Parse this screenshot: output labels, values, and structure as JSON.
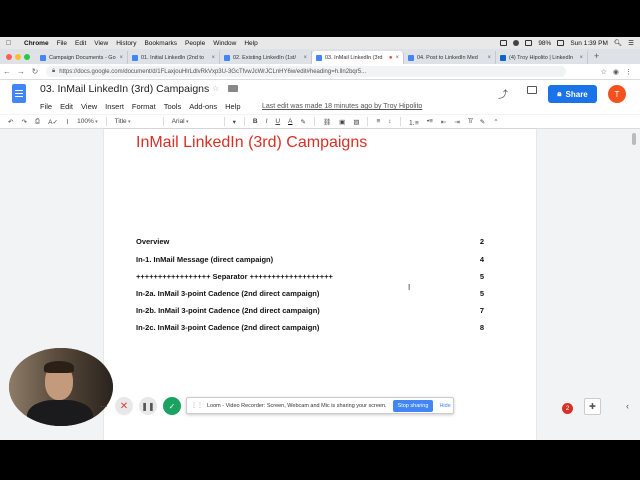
{
  "menubar": {
    "apple": "",
    "app": "Chrome",
    "items": [
      "File",
      "Edit",
      "View",
      "History",
      "Bookmarks",
      "People",
      "Window",
      "Help"
    ],
    "battery": "98%",
    "time": "Sun 1:39 PM"
  },
  "tabs": [
    {
      "title": "Campaign Documents - Go",
      "active": false
    },
    {
      "title": "01. Initial LinkedIn (2nd to",
      "active": false
    },
    {
      "title": "02. Existing LinkedIn (1st/",
      "active": false
    },
    {
      "title": "03. InMail LinkedIn (3rd",
      "active": true
    },
    {
      "title": "04. Post to LinkedIn Med",
      "active": false
    },
    {
      "title": "(4) Troy Hipolito | LinkedIn",
      "active": false
    }
  ],
  "address": {
    "url": "https://docs.google.com/document/d/1FLaxjouHlrLdlvRkVxp3U-3GcTfvwJcWrJCLnHY6w/edit#heading=h.lln2bqr5..."
  },
  "doc": {
    "title": "03. InMail LinkedIn (3rd) Campaigns",
    "menu": [
      "File",
      "Edit",
      "View",
      "Insert",
      "Format",
      "Tools",
      "Add-ons",
      "Help"
    ],
    "last_edit": "Last edit was made 18 minutes ago by Troy Hipolito",
    "share_label": "Share",
    "avatar_letter": "T"
  },
  "toolbar": {
    "zoom": "100%",
    "style": "Title",
    "font": "Arial",
    "bold": "B",
    "italic": "I",
    "underline": "U",
    "text_color": "A"
  },
  "page": {
    "heading": "InMail LinkedIn (3rd) Campaigns",
    "toc": [
      {
        "text": "Overview",
        "page": "2"
      },
      {
        "text": "In-1. InMail Message (direct campaign)",
        "page": "4"
      },
      {
        "text": "+++++++++++++++++ Separator +++++++++++++++++++",
        "page": "5"
      },
      {
        "text": "In-2a. InMail 3-point Cadence (2nd direct campaign)",
        "page": "5"
      },
      {
        "text": "In-2b. InMail 3-point Cadence (2nd direct campaign)",
        "page": "7"
      },
      {
        "text": "In-2c. InMail 3-point Cadence (2nd direct campaign)",
        "page": "8"
      }
    ]
  },
  "notifications_count": "2",
  "loom": {
    "message": "Loom - Video Recorder: Screen, Webcam and Mic is sharing your screen.",
    "stop_label": "Stop sharing",
    "hide_label": "Hide"
  },
  "colors": {
    "heading_red": "#d93025",
    "share_blue": "#1a73e8",
    "avatar_orange": "#f4511e"
  }
}
